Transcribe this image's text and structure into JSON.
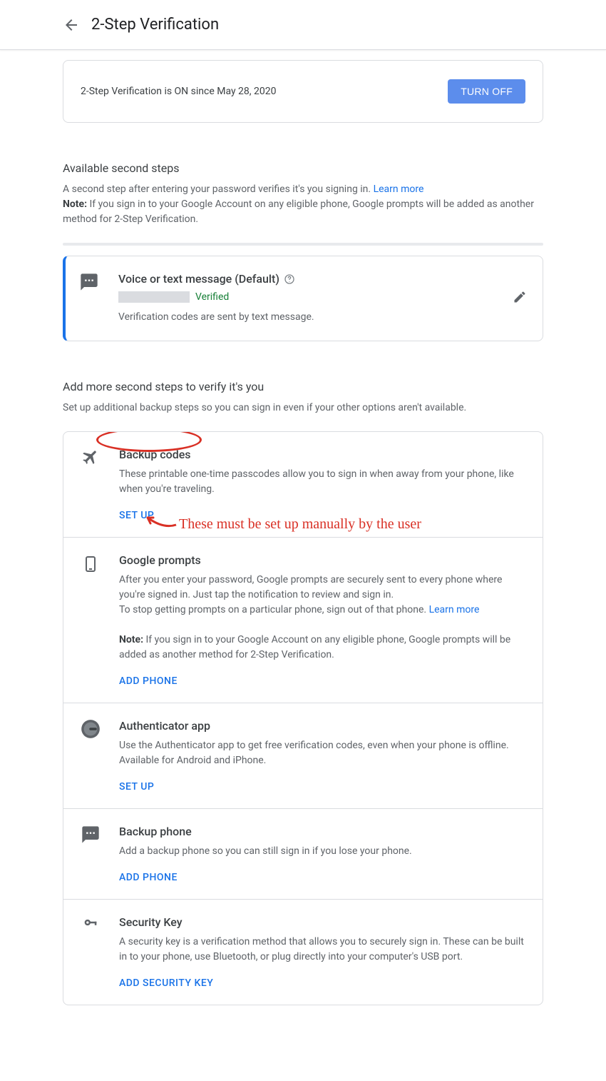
{
  "header": {
    "title": "2-Step Verification"
  },
  "status": {
    "text": "2-Step Verification is ON since May 28, 2020",
    "button": "TURN OFF"
  },
  "available": {
    "heading": "Available second steps",
    "desc1": "A second step after entering your password verifies it's you signing in. ",
    "learn_more": "Learn more",
    "note_label": "Note:",
    "note_text": " If you sign in to your Google Account on any eligible phone, Google prompts will be added as another method for 2-Step Verification."
  },
  "default_method": {
    "title": "Voice or text message (Default)",
    "verified": "Verified",
    "desc": "Verification codes are sent by text message."
  },
  "more": {
    "heading": "Add more second steps to verify it's you",
    "desc": "Set up additional backup steps so you can sign in even if your other options aren't available."
  },
  "methods": {
    "backup_codes": {
      "title": "Backup codes",
      "desc": "These printable one-time passcodes allow you to sign in when away from your phone, like when you're traveling.",
      "action": "SET UP"
    },
    "google_prompts": {
      "title": "Google prompts",
      "desc1": "After you enter your password, Google prompts are securely sent to every phone where you're signed in. Just tap the notification to review and sign in.",
      "desc2": "To stop getting prompts on a particular phone, sign out of that phone. ",
      "learn_more": "Learn more",
      "note_label": "Note:",
      "note_text": " If you sign in to your Google Account on any eligible phone, Google prompts will be added as another method for 2-Step Verification.",
      "action": "ADD PHONE"
    },
    "authenticator": {
      "title": "Authenticator app",
      "desc": "Use the Authenticator app to get free verification codes, even when your phone is offline. Available for Android and iPhone.",
      "action": "SET UP"
    },
    "backup_phone": {
      "title": "Backup phone",
      "desc": "Add a backup phone so you can still sign in if you lose your phone.",
      "action": "ADD PHONE"
    },
    "security_key": {
      "title": "Security Key",
      "desc": "A security key is a verification method that allows you to securely sign in. These can be built in to your phone, use Bluetooth, or plug directly into your computer's USB port.",
      "action": "ADD SECURITY KEY"
    }
  },
  "annotation": {
    "text": "These must be set up manually by the user"
  }
}
